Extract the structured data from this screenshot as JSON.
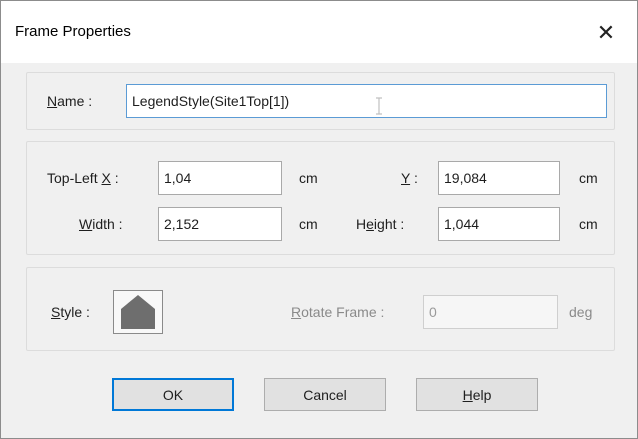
{
  "window": {
    "title": "Frame Properties",
    "close_glyph": "✕"
  },
  "name_group": {
    "label_prefix": "",
    "label_key": "N",
    "label_rest": "ame :",
    "value": "LegendStyle(Site1Top[1])"
  },
  "geometry_group": {
    "topleft_x": {
      "label_pre": "Top-Left ",
      "label_key": "X",
      "label_post": " :",
      "value": "1,04",
      "unit": "cm"
    },
    "y": {
      "label_key": "Y",
      "label_post": " :",
      "value": "19,084",
      "unit": "cm"
    },
    "width": {
      "label_key": "W",
      "label_post": "idth :",
      "value": "2,152",
      "unit": "cm"
    },
    "height": {
      "label_pre": "H",
      "label_key": "e",
      "label_post": "ight :",
      "value": "1,044",
      "unit": "cm"
    }
  },
  "style_group": {
    "style_label_key": "S",
    "style_label_rest": "tyle :",
    "rotate_label_key": "R",
    "rotate_label_rest": "otate Frame :",
    "rotate_value": "0",
    "rotate_unit": "deg"
  },
  "buttons": {
    "ok": "OK",
    "cancel": "Cancel",
    "help_key": "H",
    "help_rest": "elp"
  },
  "colors": {
    "focus_border": "#5b9bd5",
    "default_button_border": "#0078d7",
    "swatch_fill": "#6e6e6e"
  }
}
